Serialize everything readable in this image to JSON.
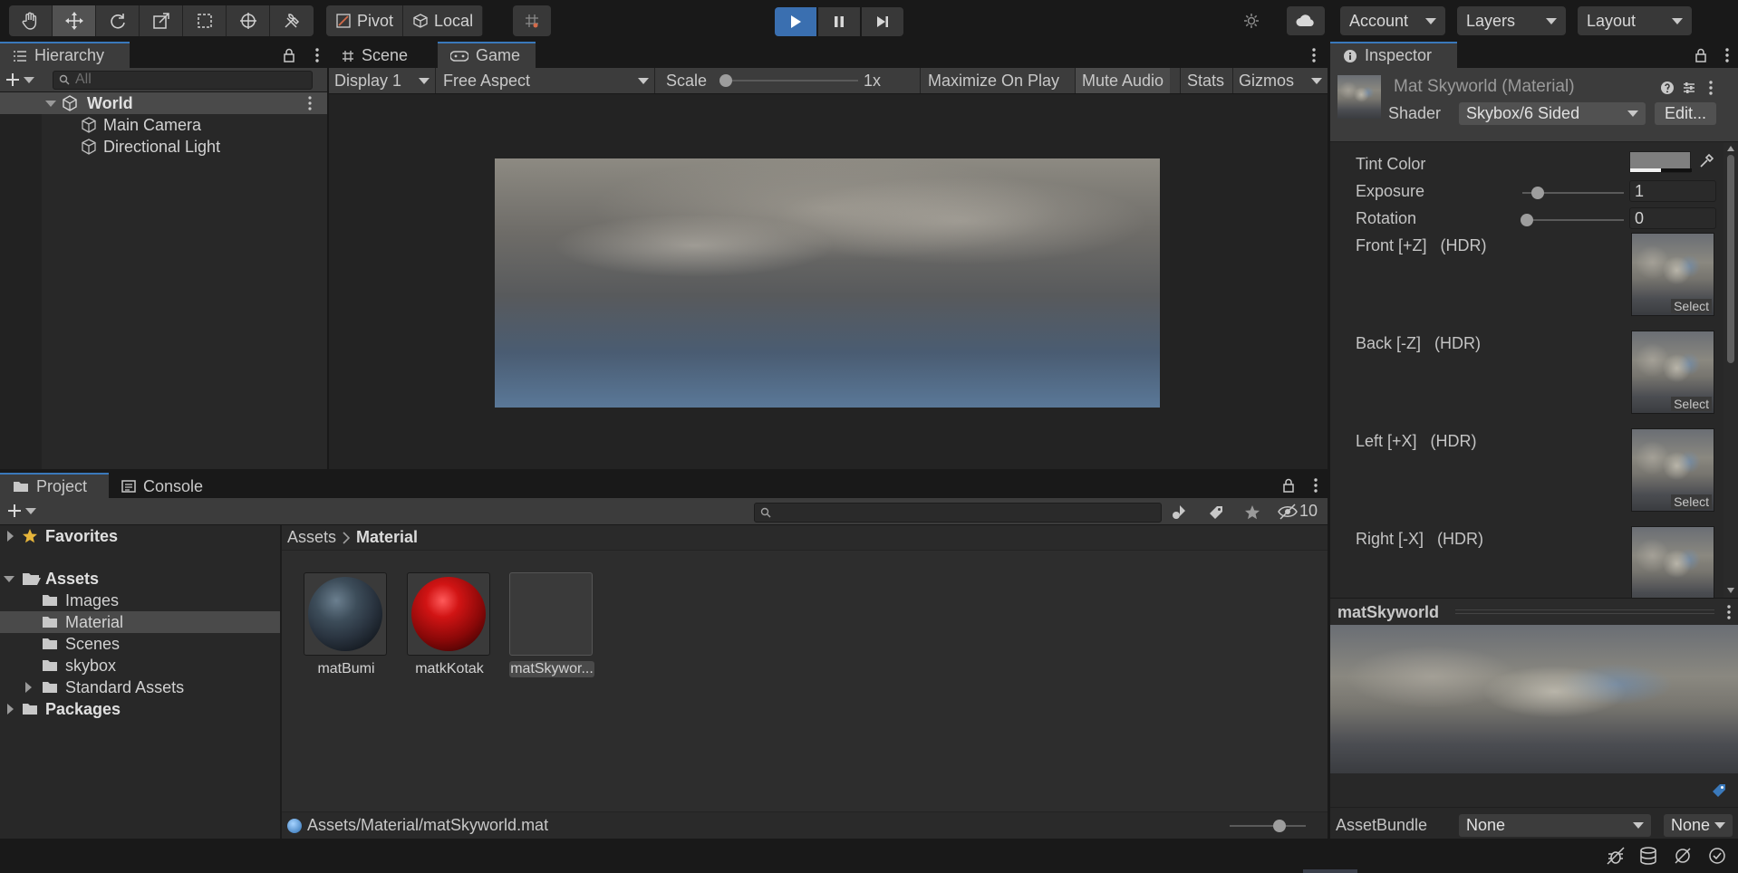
{
  "toolbar": {
    "pivot": "Pivot",
    "local": "Local",
    "account": "Account",
    "layers": "Layers",
    "layout": "Layout"
  },
  "hierarchy": {
    "tab": "Hierarchy",
    "search_placeholder": "All",
    "scene": "World",
    "items": [
      "Main Camera",
      "Directional Light"
    ]
  },
  "center": {
    "tabs": {
      "scene": "Scene",
      "game": "Game"
    },
    "display": "Display 1",
    "aspect": "Free Aspect",
    "scale_label": "Scale",
    "scale_value": "1x",
    "scale_fraction": 0.0,
    "buttons": {
      "maximize": "Maximize On Play",
      "mute": "Mute Audio",
      "stats": "Stats",
      "gizmos": "Gizmos"
    }
  },
  "project": {
    "tabs": {
      "project": "Project",
      "console": "Console"
    },
    "hidden_count": "10",
    "favorites": "Favorites",
    "assets": "Assets",
    "folders": [
      "Images",
      "Material",
      "Scenes",
      "skybox",
      "Standard Assets"
    ],
    "packages": "Packages",
    "breadcrumb": {
      "root": "Assets",
      "current": "Material"
    },
    "items": [
      "matBumi",
      "matkKotak",
      "matSkywor..."
    ],
    "status_path": "Assets/Material/matSkyworld.mat"
  },
  "inspector": {
    "tab": "Inspector",
    "title": "Mat Skyworld (Material)",
    "shader_label": "Shader",
    "shader_value": "Skybox/6 Sided",
    "edit_button": "Edit...",
    "tint_label": "Tint Color",
    "exposure_label": "Exposure",
    "exposure_value": "1",
    "rotation_label": "Rotation",
    "rotation_value": "0",
    "textures": [
      "Front [+Z]   (HDR)",
      "Back [-Z]   (HDR)",
      "Left [+X]   (HDR)",
      "Right [-X]   (HDR)"
    ],
    "select_label": "Select",
    "preview_title": "matSkyworld",
    "assetbundle_label": "AssetBundle",
    "assetbundle_value": "None",
    "variant_value": "None"
  },
  "colors": {
    "accent": "#3a79bb",
    "play_active": "#3a6fb0",
    "panel_bg": "#282828",
    "toolbar_bg": "#191919"
  }
}
